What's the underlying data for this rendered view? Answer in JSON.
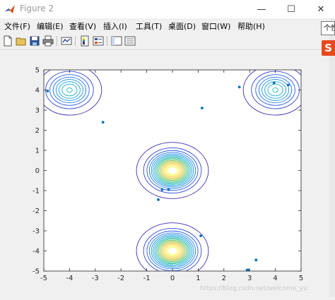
{
  "window": {
    "title": "Figure 2",
    "minimize_glyph": "—",
    "maximize_glyph": "☐",
    "close_glyph": "✕"
  },
  "menu": [
    {
      "label": "文件(F)"
    },
    {
      "label": "编辑(E)"
    },
    {
      "label": "查看(V)"
    },
    {
      "label": "插入(I)"
    },
    {
      "label": "工具(T)"
    },
    {
      "label": "桌面(D)"
    },
    {
      "label": "窗口(W)"
    },
    {
      "label": "帮助(H)"
    }
  ],
  "toolbar_icons": [
    "new-figure-icon",
    "open-file-icon",
    "save-icon",
    "print-icon",
    "link-plot-icon",
    "insert-colorbar-icon",
    "insert-legend-icon",
    "hide-plot-tools-icon",
    "show-plot-tools-icon"
  ],
  "tooltip": {
    "text": "个性"
  },
  "ime_badge": {
    "text": "S"
  },
  "watermark": "https://blog.csdn.net/welcome_yu",
  "colors": {
    "contour_low": "#3e2a84",
    "contour_mid": "#2a9d8f",
    "contour_high": "#f9e721",
    "scatter": "#0072bd"
  },
  "chart_data": {
    "type": "contour",
    "xlim": [
      -5,
      5
    ],
    "ylim": [
      -5,
      5
    ],
    "x_ticks": [
      -5,
      -4,
      -3,
      -2,
      -1,
      0,
      1,
      2,
      3,
      4,
      5
    ],
    "y_ticks": [
      -5,
      -4,
      -3,
      -2,
      -1,
      0,
      1,
      2,
      3,
      4,
      5
    ],
    "grid": false,
    "contour_centers": [
      {
        "x": 0,
        "y": 0,
        "peak": 1.0
      },
      {
        "x": 0,
        "y": -4,
        "peak": 1.0
      },
      {
        "x": -4,
        "y": 4,
        "peak": 0.45
      },
      {
        "x": 4,
        "y": 4,
        "peak": 0.45
      }
    ],
    "scatter": {
      "x": [
        -4.85,
        -2.7,
        1.15,
        2.6,
        3.95,
        4.5,
        -0.4,
        -0.15,
        -0.55,
        1.1,
        3.25,
        2.9,
        2.95
      ],
      "y": [
        3.95,
        2.4,
        3.1,
        4.15,
        4.35,
        4.25,
        -0.95,
        -0.95,
        -1.45,
        -3.25,
        -4.45,
        -4.95,
        -4.95
      ]
    }
  }
}
